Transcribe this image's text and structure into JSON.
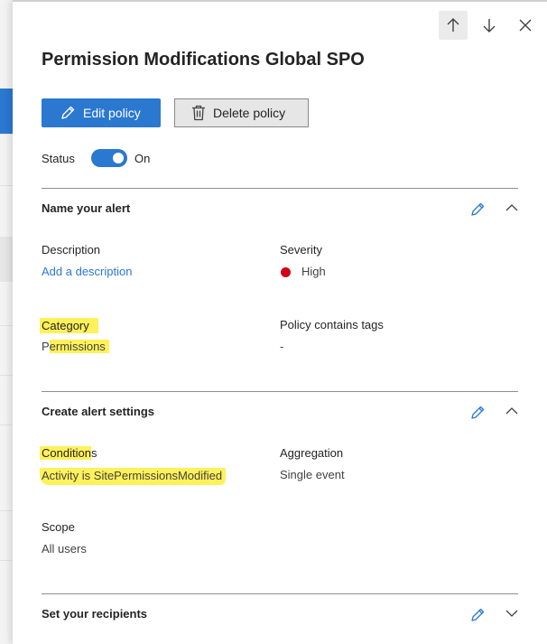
{
  "panel": {
    "title": "Permission Modifications Global SPO",
    "edit_label": "Edit policy",
    "delete_label": "Delete policy",
    "status_label": "Status",
    "status_value": "On"
  },
  "section_name": {
    "title": "Name your alert",
    "description_label": "Description",
    "description_value": "Add a description",
    "severity_label": "Severity",
    "severity_value": "High",
    "category_label": "Category",
    "category_value": "Permissions",
    "tags_label": "Policy contains tags",
    "tags_value": "-"
  },
  "section_settings": {
    "title": "Create alert settings",
    "conditions_label": "Conditions",
    "conditions_value": "Activity is SitePermissionsModified",
    "aggregation_label": "Aggregation",
    "aggregation_value": "Single event",
    "scope_label": "Scope",
    "scope_value": "All users"
  },
  "section_recipients": {
    "title": "Set your recipients"
  },
  "icons": {
    "nav_up": "arrow-up-icon",
    "nav_down": "arrow-down-icon",
    "close": "close-icon",
    "edit": "pencil-icon",
    "delete": "trash-icon",
    "collapse": "chevron-up-icon",
    "expand": "chevron-down-icon"
  },
  "colors": {
    "accent": "#2b78d0",
    "severity_high": "#d0021b",
    "highlight": "#fff15a"
  }
}
